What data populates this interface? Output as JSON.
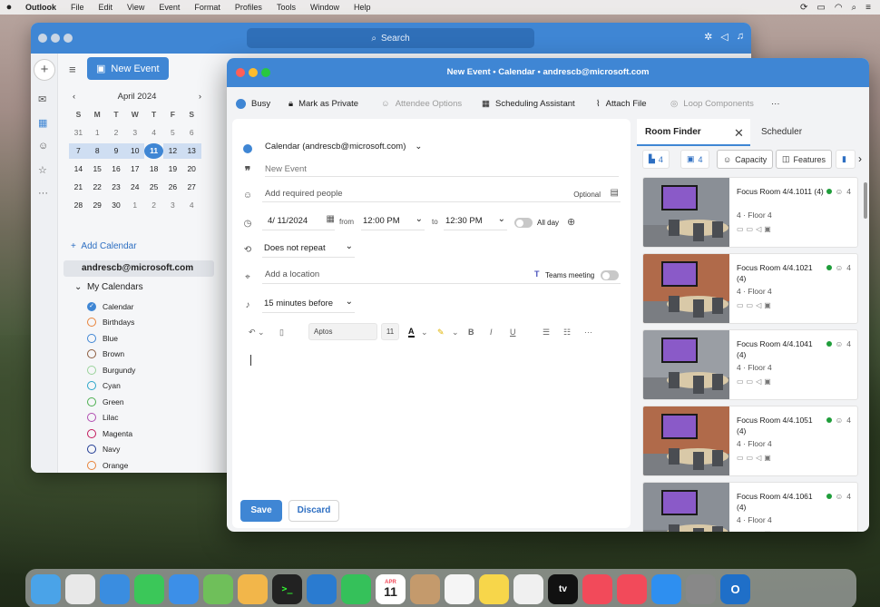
{
  "menubar": {
    "app": "Outlook",
    "items": [
      "File",
      "Edit",
      "View",
      "Event",
      "Format",
      "Profiles",
      "Tools",
      "Window",
      "Help"
    ]
  },
  "main_window": {
    "search_placeholder": "Search",
    "new_event_label": "New Event",
    "minical": {
      "month_label": "April 2024",
      "dow": [
        "S",
        "M",
        "T",
        "W",
        "T",
        "F",
        "S"
      ],
      "weeks": [
        [
          "31",
          "1",
          "2",
          "3",
          "4",
          "5",
          "6"
        ],
        [
          "7",
          "8",
          "9",
          "10",
          "11",
          "12",
          "13"
        ],
        [
          "14",
          "15",
          "16",
          "17",
          "18",
          "19",
          "20"
        ],
        [
          "21",
          "22",
          "23",
          "24",
          "25",
          "26",
          "27"
        ],
        [
          "28",
          "29",
          "30",
          "1",
          "2",
          "3",
          "4"
        ]
      ],
      "today": "11"
    },
    "add_calendar_label": "Add Calendar",
    "account": "andrescb@microsoft.com",
    "my_calendars_label": "My Calendars",
    "calendars": [
      {
        "name": "Calendar",
        "color": "#3f86d4",
        "checked": true
      },
      {
        "name": "Birthdays",
        "color": "#e8833a"
      },
      {
        "name": "Blue",
        "color": "#3f86d4"
      },
      {
        "name": "Brown",
        "color": "#8a5a3c"
      },
      {
        "name": "Burgundy",
        "color": "#9ad29a"
      },
      {
        "name": "Cyan",
        "color": "#2aa6c9"
      },
      {
        "name": "Green",
        "color": "#4caf50"
      },
      {
        "name": "Lilac",
        "color": "#b04bb0"
      },
      {
        "name": "Magenta",
        "color": "#c2185b"
      },
      {
        "name": "Navy",
        "color": "#1f3a93"
      },
      {
        "name": "Orange",
        "color": "#e8833a"
      }
    ]
  },
  "event_window": {
    "title": "New Event • Calendar • andrescb@microsoft.com",
    "toolbar": {
      "busy": "Busy",
      "private": "Mark as Private",
      "attendee": "Attendee Options",
      "scheduling": "Scheduling Assistant",
      "attach": "Attach File",
      "loop": "Loop Components",
      "more": "···"
    },
    "form": {
      "calendar": "Calendar (andrescb@microsoft.com)",
      "title_placeholder": "New Event",
      "people_placeholder": "Add required people",
      "optional": "Optional",
      "date": "4/ 11/2024",
      "from_label": "from",
      "start": "12:00 PM",
      "to_label": "to",
      "end": "12:30 PM",
      "all_day": "All day",
      "repeat": "Does not repeat",
      "location_placeholder": "Add a location",
      "teams": "Teams meeting",
      "reminder": "15 minutes before",
      "font": "Aptos",
      "size": "11",
      "save": "Save",
      "discard": "Discard"
    },
    "panel": {
      "tab_room_finder": "Room Finder",
      "tab_scheduler": "Scheduler",
      "filter_building": "4",
      "filter_floor": "4",
      "filter_capacity": "Capacity",
      "filter_features": "Features",
      "rooms": [
        {
          "name": "Focus Room 4/4.1011 (4)",
          "cap": "4",
          "floor": "4 · Floor 4"
        },
        {
          "name": "Focus Room 4/4.1021 (4)",
          "cap": "4",
          "floor": "4 · Floor 4"
        },
        {
          "name": "Focus Room 4/4.1041 (4)",
          "cap": "4",
          "floor": "4 · Floor 4"
        },
        {
          "name": "Focus Room 4/4.1051 (4)",
          "cap": "4",
          "floor": "4 · Floor 4"
        },
        {
          "name": "Focus Room 4/4.1061 (4)",
          "cap": "4",
          "floor": "4 · Floor 4"
        }
      ]
    }
  },
  "dock": {
    "apps": [
      {
        "name": "finder",
        "color": "#4aa3e8"
      },
      {
        "name": "launchpad",
        "color": "#e8e8e8"
      },
      {
        "name": "safari",
        "color": "#3a8de0"
      },
      {
        "name": "messages",
        "color": "#3bc759"
      },
      {
        "name": "mail",
        "color": "#3c8fe8"
      },
      {
        "name": "maps",
        "color": "#6fbf5a"
      },
      {
        "name": "photos",
        "color": "#f2b64a"
      },
      {
        "name": "terminal",
        "color": "#222222"
      },
      {
        "name": "vscode",
        "color": "#2a7bd0"
      },
      {
        "name": "facetime",
        "color": "#35c15a"
      },
      {
        "name": "calendar",
        "color": "#ffffff"
      },
      {
        "name": "contacts",
        "color": "#c49a6c"
      },
      {
        "name": "reminders",
        "color": "#f5f5f5"
      },
      {
        "name": "notes",
        "color": "#f7d64a"
      },
      {
        "name": "freeform",
        "color": "#f0f0f0"
      },
      {
        "name": "appletv",
        "color": "#111111"
      },
      {
        "name": "music",
        "color": "#f24a5a"
      },
      {
        "name": "news",
        "color": "#f24a5a"
      },
      {
        "name": "appstore",
        "color": "#2e8ff0"
      },
      {
        "name": "settings",
        "color": "#888888"
      },
      {
        "name": "outlook",
        "color": "#1f6fc8"
      }
    ],
    "calendar_month": "APR",
    "calendar_day": "11",
    "tv_label": "tv"
  }
}
